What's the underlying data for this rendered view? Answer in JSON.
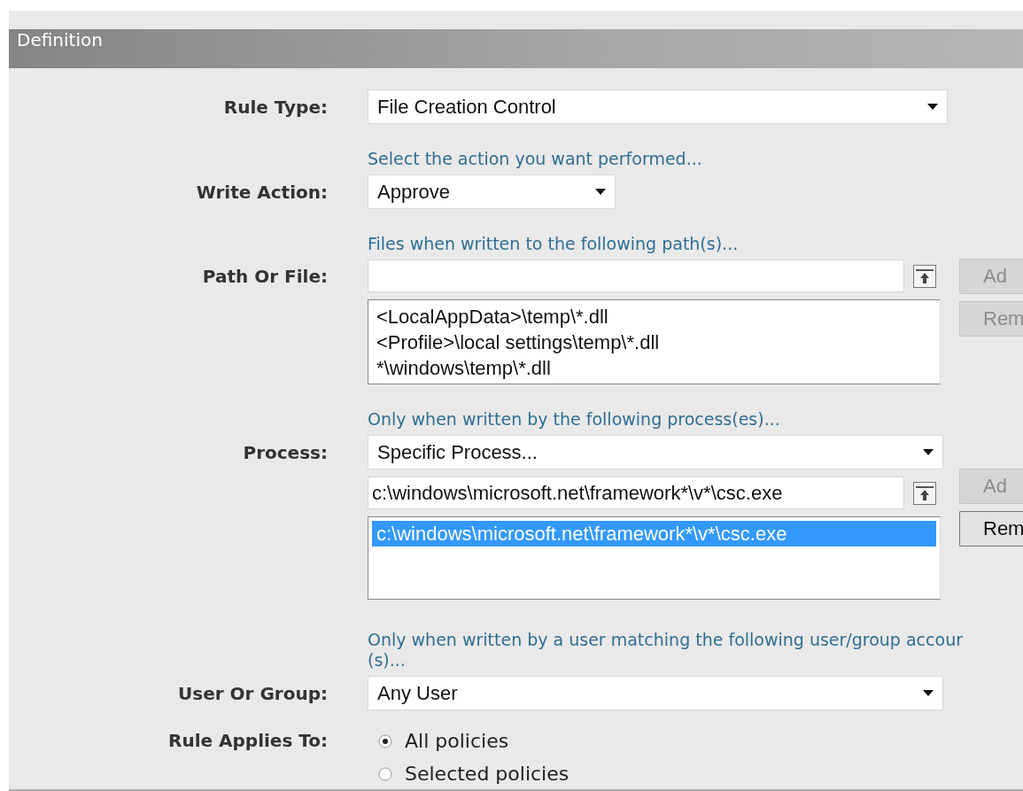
{
  "section_title": "Definition",
  "rule_type": {
    "label": "Rule Type:",
    "value": "File Creation Control"
  },
  "write_action": {
    "label": "Write Action:",
    "hint": "Select the action you want performed...",
    "value": "Approve"
  },
  "path_or_file": {
    "label": "Path Or File:",
    "hint": "Files when written to the following path(s)...",
    "items": [
      {
        "text": "<LocalAppData>\\temp\\*.dll",
        "selected": false
      },
      {
        "text": "<Profile>\\local settings\\temp\\*.dll",
        "selected": false
      },
      {
        "text": "*\\windows\\temp\\*.dll",
        "selected": false
      }
    ],
    "buttons": [
      {
        "label": "Ad",
        "disabled": true
      },
      {
        "label": "Rem",
        "disabled": true
      }
    ]
  },
  "process": {
    "label": "Process:",
    "hint": "Only when written by the following process(es)...",
    "selector": "Specific Process...",
    "input_value": "c:\\windows\\microsoft.net\\framework*\\v*\\csc.exe",
    "items": [
      {
        "text": "c:\\windows\\microsoft.net\\framework*\\v*\\csc.exe",
        "selected": true
      }
    ],
    "buttons": [
      {
        "label": "Ad",
        "disabled": true
      },
      {
        "label": "Rem",
        "disabled": false
      }
    ]
  },
  "user_or_group": {
    "label": "User Or Group:",
    "hint_lines": [
      "Only when written by a user matching the following user/group accour",
      "(s)..."
    ],
    "value": "Any User"
  },
  "rule_applies_to": {
    "label": "Rule Applies To:",
    "options": [
      {
        "label": "All policies",
        "selected": true
      },
      {
        "label": "Selected policies",
        "selected": false
      }
    ]
  }
}
